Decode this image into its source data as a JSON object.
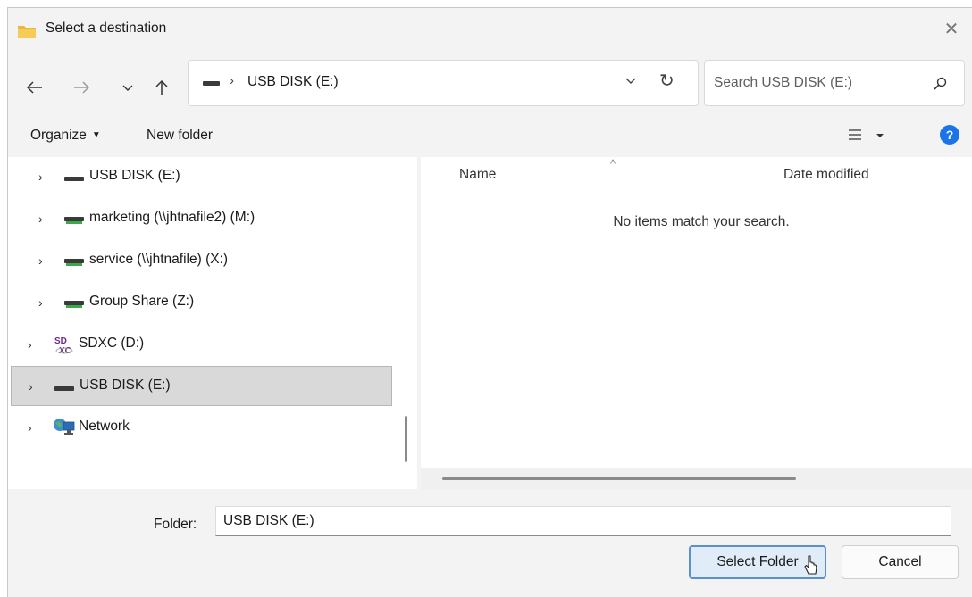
{
  "window": {
    "title": "Select a destination",
    "close_icon": "close-icon"
  },
  "nav": {
    "back_icon": "arrow-left-icon",
    "forward_icon": "arrow-right-icon",
    "recent_icon": "chevron-down-icon",
    "up_icon": "arrow-up-icon"
  },
  "address": {
    "separator": "›",
    "location": "USB DISK (E:)"
  },
  "search": {
    "placeholder": "Search USB DISK (E:)",
    "value": ""
  },
  "toolbar": {
    "organize_label": "Organize",
    "new_folder_label": "New folder",
    "help_label": "?"
  },
  "tree": {
    "items": [
      {
        "label": "USB DISK (E:)",
        "icon": "drive-icon"
      },
      {
        "label": "marketing (\\\\jhtnafile2) (M:)",
        "icon": "network-drive-icon"
      },
      {
        "label": "service (\\\\jhtnafile) (X:)",
        "icon": "network-drive-icon"
      },
      {
        "label": "Group Share (Z:)",
        "icon": "network-drive-icon"
      },
      {
        "label": "SDXC (D:)",
        "icon": "sd-card-icon"
      },
      {
        "label": "USB DISK (E:)",
        "icon": "drive-icon",
        "selected": true
      },
      {
        "label": "Network",
        "icon": "network-icon"
      }
    ]
  },
  "filelist": {
    "columns": [
      "Name",
      "Date modified"
    ],
    "empty_message": "No items match your search."
  },
  "footer": {
    "folder_label": "Folder:",
    "folder_value": "USB DISK (E:)",
    "select_button": "Select Folder",
    "cancel_button": "Cancel"
  },
  "colors": {
    "accent": "#1a73e8",
    "selected_bg": "#d9d9d9",
    "primary_button_border": "#5b8fd1"
  }
}
